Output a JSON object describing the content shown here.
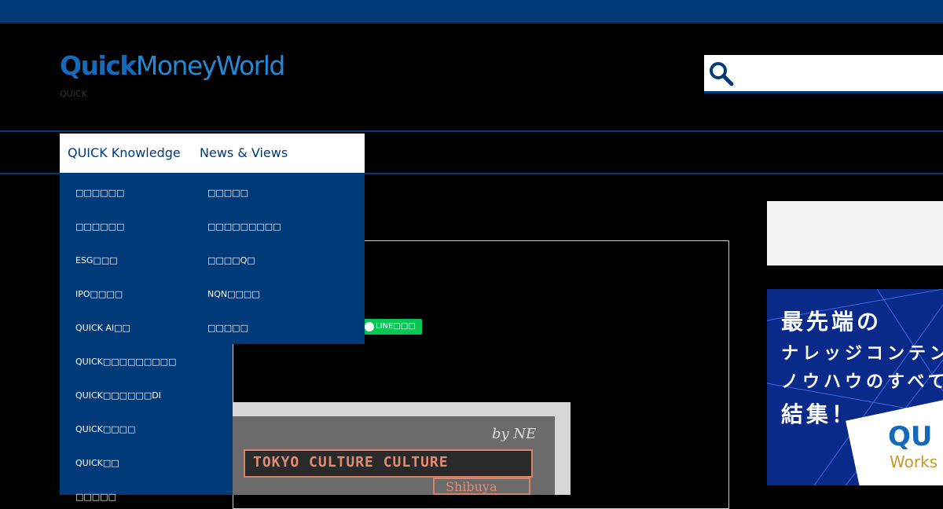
{
  "header": {
    "logo_quick": "Quick",
    "logo_money": "MoneyWorld",
    "tagline": "QUICK",
    "search_placeholder": ""
  },
  "nav": {
    "items": [
      "QUICK Knowledge",
      "News & Views"
    ]
  },
  "dropdown_left": [
    "□□□□□□",
    "□□□□□□",
    "ESG□□□",
    "IPO□□□□",
    "QUICK AI□□",
    "QUICK□□□□□□□□□",
    "QUICK□□□□□□DI",
    "QUICK□□□□",
    "QUICK□□",
    "□□□□□"
  ],
  "dropdown_right": [
    "□□□□□",
    "□□□□□□□□□",
    "□□□□Q□",
    "NQN□□□□",
    "□□□□□"
  ],
  "share": {
    "line_label": "LINE□□□"
  },
  "photo": {
    "sign": "TOKYO CULTURE CULTURE",
    "script": "by NE",
    "sub": "Shibuya"
  },
  "banner": {
    "line1": "最先端の",
    "line2": "ナレッジコンテン",
    "line3": "ノウハウのすべて",
    "line4": "結集！",
    "logo": "QU",
    "works": "Works"
  }
}
